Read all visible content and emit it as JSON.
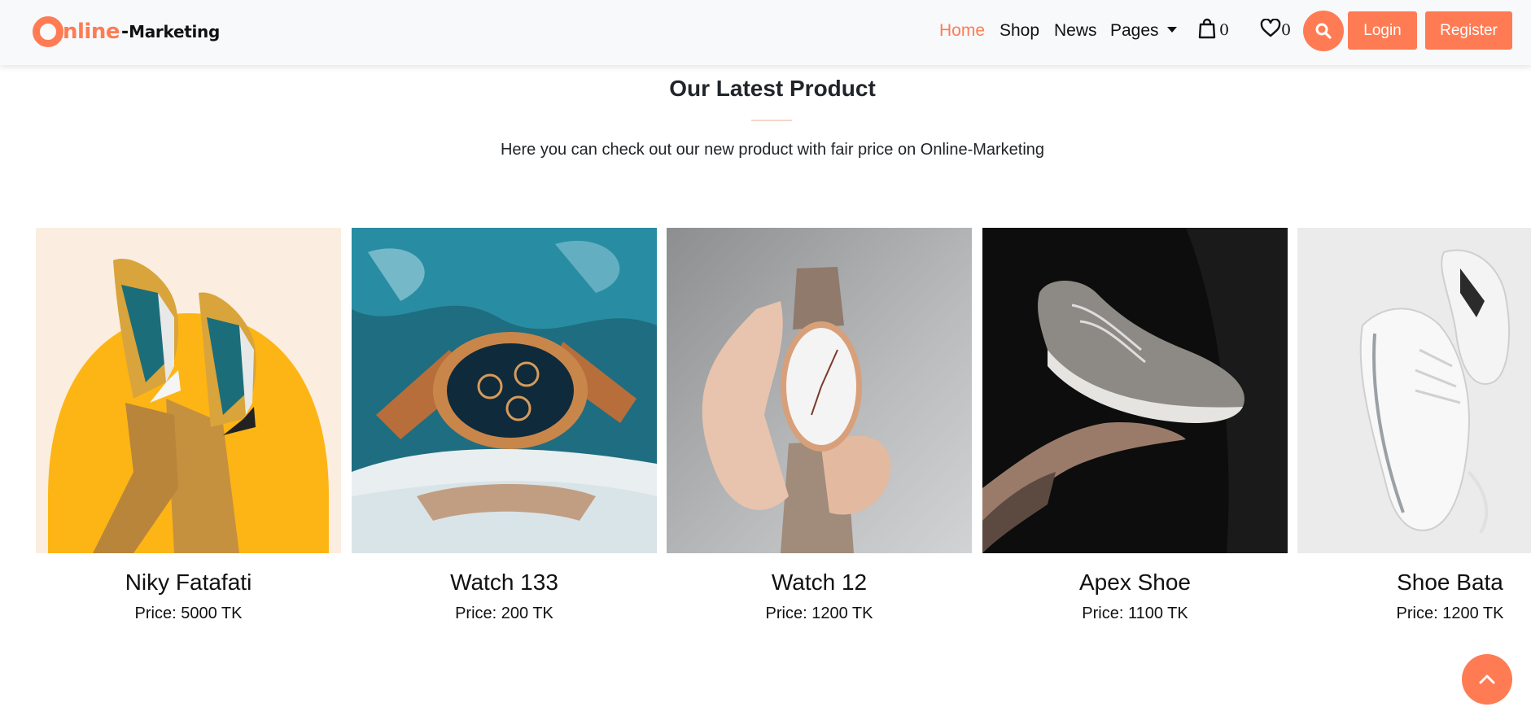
{
  "brand": {
    "name_part1": "nline",
    "name_dash": "-",
    "name_part2": "Marketing",
    "accent_color": "#ff7b54"
  },
  "nav": {
    "home": "Home",
    "shop": "Shop",
    "news": "News",
    "pages": "Pages",
    "cart_count": "0",
    "wishlist_count": "0",
    "login": "Login",
    "register": "Register",
    "icons": {
      "cart": "shopping-bag-icon",
      "wishlist": "heart-icon",
      "search": "search-icon",
      "pages_menu": "caret-down-icon"
    }
  },
  "section": {
    "title": "Our Latest Product",
    "subtitle": "Here you can check out our new product with fair price on Online-Marketing"
  },
  "products": [
    {
      "name": "Niky Fatafati",
      "price": "Price: 5000 TK"
    },
    {
      "name": "Watch 133",
      "price": "Price: 200 TK"
    },
    {
      "name": "Watch 12",
      "price": "Price: 1200 TK"
    },
    {
      "name": "Apex Shoe",
      "price": "Price: 1100 TK"
    },
    {
      "name": "Shoe Bata",
      "price": "Price: 1200 TK"
    }
  ],
  "scroll_top_icon": "chevron-up-icon"
}
